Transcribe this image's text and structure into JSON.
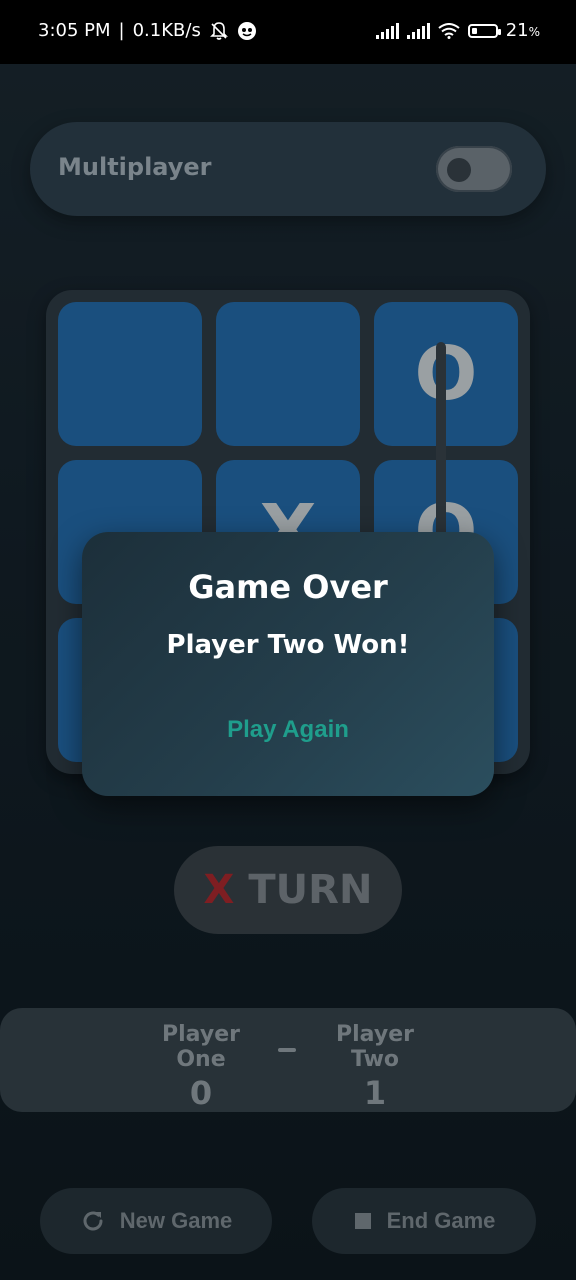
{
  "status": {
    "time": "3:05 PM",
    "speed": "0.1KB/s",
    "battery": "21",
    "battery_unit": "%"
  },
  "multiplayer": {
    "label": "Multiplayer",
    "enabled": false
  },
  "board": {
    "cells": [
      "",
      "",
      "O",
      "",
      "X",
      "O",
      "",
      "",
      ""
    ]
  },
  "dialog": {
    "title": "Game Over",
    "message": "Player Two Won!",
    "action": "Play Again"
  },
  "turn": {
    "symbol": "X",
    "label": "TURN"
  },
  "score": {
    "player_one_name": "Player One",
    "player_one_score": "0",
    "player_two_name": "Player Two",
    "player_two_score": "1",
    "separator": "-"
  },
  "buttons": {
    "new_game": "New Game",
    "end_game": "End Game"
  },
  "colors": {
    "accent": "#1f9e8c",
    "cell": "#1a4f7e",
    "x_color": "#7e1e22"
  }
}
